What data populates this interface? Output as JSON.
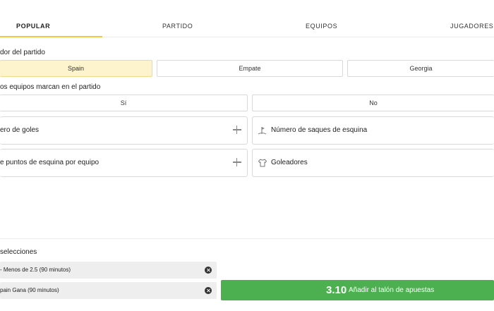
{
  "tabs": [
    {
      "label": "POPULAR",
      "active": true
    },
    {
      "label": "PARTIDO",
      "active": false
    },
    {
      "label": "EQUIPOS",
      "active": false
    },
    {
      "label": "JUGADORES",
      "active": false
    }
  ],
  "markets": {
    "winner": {
      "title": "dor del partido",
      "options": [
        "Spain",
        "Empate",
        "Georgia"
      ],
      "selected": "Spain"
    },
    "both_score": {
      "title": "os equipos marcan en el partido",
      "options": [
        "Sí",
        "No"
      ]
    },
    "cards": [
      {
        "label": "ero de goles",
        "icon": "plus-icon"
      },
      {
        "label": "Número de saques de esquina",
        "icon": "corner-flag-icon"
      },
      {
        "label": "e puntos de esquina por equipo",
        "icon": "plus-icon"
      },
      {
        "label": "Goleadores",
        "icon": "jersey-icon"
      }
    ]
  },
  "betslip": {
    "title": "selecciones",
    "selections": [
      {
        "label": "- Menos de 2.5 (90 minutos)",
        "icon": "remove-icon"
      },
      {
        "label": "pain Gana (90 minutos)",
        "icon": "remove-icon"
      }
    ],
    "odds": "3.10",
    "add_label": "Añadir al talón de apuestas"
  },
  "colors": {
    "accent": "#f5c842",
    "selected_bg": "#fdf3cc",
    "cta": "#4caf50"
  }
}
